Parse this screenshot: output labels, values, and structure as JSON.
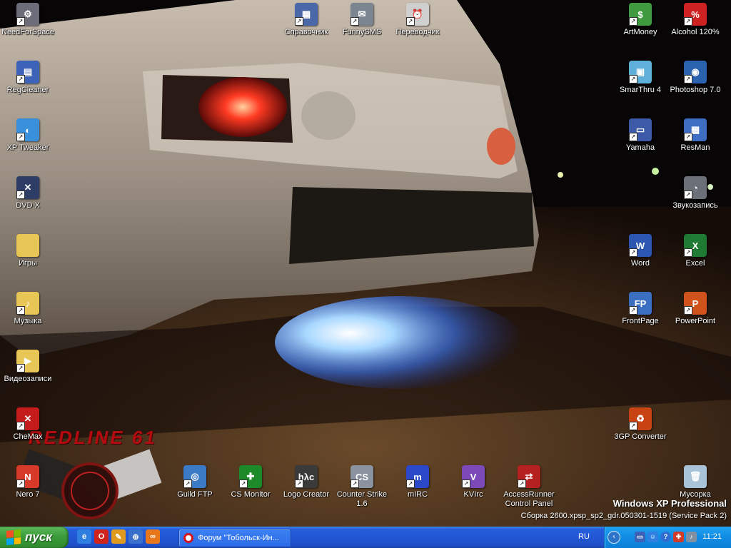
{
  "wallpaper": {
    "caption_edition": "Windows XP Professional",
    "caption_build": "Сборка 2600.xpsp_sp2_gdr.050301-1519 (Service Pack 2)",
    "logo_text": "REDLINE 61"
  },
  "icons": {
    "needforspace": {
      "label": "NeedForSpace",
      "color": "#6d6d7a",
      "glyph": "⚙"
    },
    "regcleaner": {
      "label": "RegCleaner",
      "color": "#3c63b8",
      "glyph": "▤"
    },
    "xptweaker": {
      "label": "XP Tweaker",
      "color": "#3a8fdb",
      "glyph": "◐"
    },
    "dvdx": {
      "label": "DVD X",
      "color": "#2d3d66",
      "glyph": "✕"
    },
    "games": {
      "label": "Игры",
      "color": "#e7c656",
      "glyph": ""
    },
    "music": {
      "label": "Музыка",
      "color": "#e7c656",
      "glyph": "♪"
    },
    "videos": {
      "label": "Видеозаписи",
      "color": "#e7c656",
      "glyph": "▶"
    },
    "chemax": {
      "label": "CheMax",
      "color": "#c41b1b",
      "glyph": "✕"
    },
    "nero": {
      "label": "Nero 7",
      "color": "#d83a2a",
      "glyph": "N"
    },
    "guildftp": {
      "label": "Guild FTP",
      "color": "#3b7ac5",
      "glyph": "◎"
    },
    "csmonitor": {
      "label": "CS Monitor",
      "color": "#1d8a2a",
      "glyph": "✚"
    },
    "logocreator": {
      "label": "Logo Creator",
      "color": "#3a3a3a",
      "glyph": "hλc"
    },
    "counterstrike": {
      "label": "Counter Strike\n1.6",
      "color": "#8b93a0",
      "glyph": "CS"
    },
    "mirc": {
      "label": "mIRC",
      "color": "#2b48c8",
      "glyph": "m"
    },
    "kvirc": {
      "label": "KVIrc",
      "color": "#7b4ab8",
      "glyph": "V"
    },
    "accessrunner": {
      "label": "AccessRunner\nControl Panel",
      "color": "#b52020",
      "glyph": "⇄"
    },
    "spravochnik": {
      "label": "Справочник",
      "color": "#4a67a8",
      "glyph": "▦"
    },
    "funnysms": {
      "label": "FunnySMS",
      "color": "#7a8590",
      "glyph": "✉"
    },
    "perevodchik": {
      "label": "Переводчик",
      "color": "#cfcfcf",
      "glyph": "⏰"
    },
    "artmoney": {
      "label": "ArtMoney",
      "color": "#3f9a3f",
      "glyph": "$"
    },
    "alcohol": {
      "label": "Alcohol 120%",
      "color": "#cc2222",
      "glyph": "%"
    },
    "smarthru": {
      "label": "SmarThru 4",
      "color": "#5fb0d8",
      "glyph": "▣"
    },
    "photoshop": {
      "label": "Photoshop 7.0",
      "color": "#2a62b0",
      "glyph": "◉"
    },
    "yamaha": {
      "label": "Yamaha",
      "color": "#3c5aa8",
      "glyph": "▭"
    },
    "resman": {
      "label": "ResMan",
      "color": "#3d6ec4",
      "glyph": "▦"
    },
    "zvukozapis": {
      "label": "Звукозапись",
      "color": "#6a6f78",
      "glyph": "◔"
    },
    "word": {
      "label": "Word",
      "color": "#2b57b3",
      "glyph": "W"
    },
    "excel": {
      "label": "Excel",
      "color": "#1f7a34",
      "glyph": "X"
    },
    "frontpage": {
      "label": "FrontPage",
      "color": "#3b6fc2",
      "glyph": "FP"
    },
    "powerpoint": {
      "label": "PowerPoint",
      "color": "#d0531c",
      "glyph": "P"
    },
    "threegp": {
      "label": "3GP Converter",
      "color": "#c74313",
      "glyph": "♻"
    },
    "recyclebin": {
      "label": "Мусорка",
      "color": "#a9c3d8",
      "glyph": "🗑"
    }
  },
  "taskbar": {
    "start_label": "пуск",
    "quicklaunch": [
      {
        "name": "ie-icon",
        "glyph": "e",
        "color": "#2f7fe0"
      },
      {
        "name": "opera-icon",
        "glyph": "O",
        "color": "#d0231c"
      },
      {
        "name": "pencil-icon",
        "glyph": "✎",
        "color": "#e09a1e"
      },
      {
        "name": "outlook-icon",
        "glyph": "⊕",
        "color": "#3a6fcc"
      },
      {
        "name": "link-icon",
        "glyph": "∞",
        "color": "#e8771b"
      }
    ],
    "task_opera_label": "Форум \"Тобольск-Ин...",
    "language": "RU",
    "clock": "11:21"
  }
}
